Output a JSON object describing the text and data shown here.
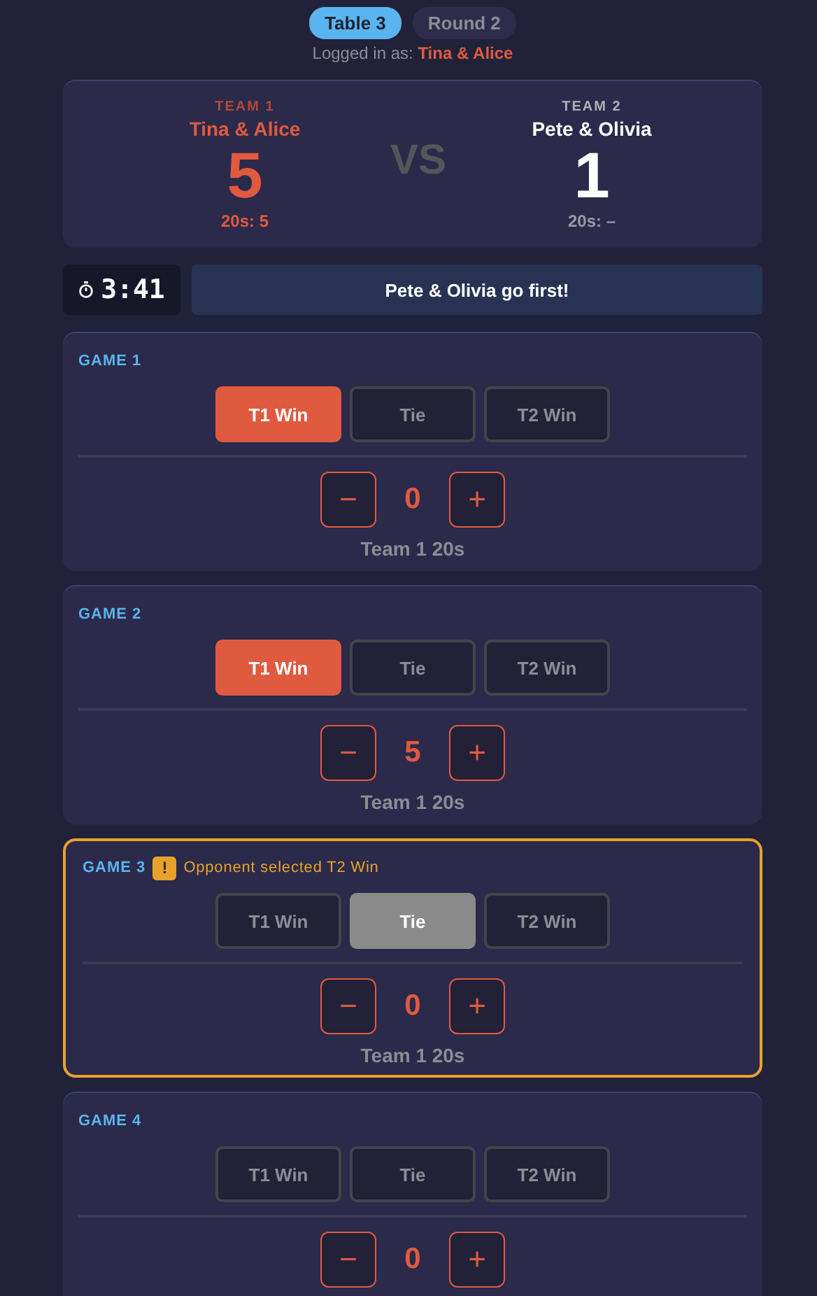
{
  "tabs": [
    {
      "label": "Table 3",
      "selected": true
    },
    {
      "label": "Round 2",
      "selected": false
    }
  ],
  "login": {
    "prefix": "Logged in as:",
    "user": "Tina & Alice"
  },
  "scoreboard": {
    "teams": [
      {
        "label": "TEAM 1",
        "name": "Tina & Alice",
        "score": "5",
        "twenties": "20s: 5",
        "mine": true
      },
      {
        "label": "TEAM 2",
        "name": "Pete & Olivia",
        "score": "1",
        "twenties": "20s: –",
        "mine": false
      }
    ],
    "vs": "VS"
  },
  "timer": "3:41",
  "banner": "Pete & Olivia go first!",
  "games": [
    {
      "title": "GAME 1",
      "options": [
        {
          "label": "T1 Win",
          "kind": "t1",
          "selected": true
        },
        {
          "label": "Tie",
          "kind": "tie",
          "selected": false
        },
        {
          "label": "T2 Win",
          "kind": "t2",
          "selected": false
        }
      ],
      "minus": "−",
      "value": "0",
      "plus": "+",
      "caption": "Team 1 20s"
    },
    {
      "title": "GAME 2",
      "options": [
        {
          "label": "T1 Win",
          "kind": "t1",
          "selected": true
        },
        {
          "label": "Tie",
          "kind": "tie",
          "selected": false
        },
        {
          "label": "T2 Win",
          "kind": "t2",
          "selected": false
        }
      ],
      "minus": "−",
      "value": "5",
      "plus": "+",
      "caption": "Team 1 20s"
    },
    {
      "title": "GAME 3",
      "warning": "Opponent selected T2 Win",
      "icon": "!",
      "options": [
        {
          "label": "T1 Win",
          "kind": "t1",
          "selected": false
        },
        {
          "label": "Tie",
          "kind": "tie",
          "selected": true
        },
        {
          "label": "T2 Win",
          "kind": "t2",
          "selected": false
        }
      ],
      "minus": "−",
      "value": "0",
      "plus": "+",
      "caption": "Team 1 20s"
    },
    {
      "title": "GAME 4",
      "options": [
        {
          "label": "T1 Win",
          "kind": "t1",
          "selected": false
        },
        {
          "label": "Tie",
          "kind": "tie",
          "selected": false
        },
        {
          "label": "T2 Win",
          "kind": "t2",
          "selected": false
        }
      ],
      "minus": "−",
      "value": "0",
      "plus": "+"
    }
  ]
}
